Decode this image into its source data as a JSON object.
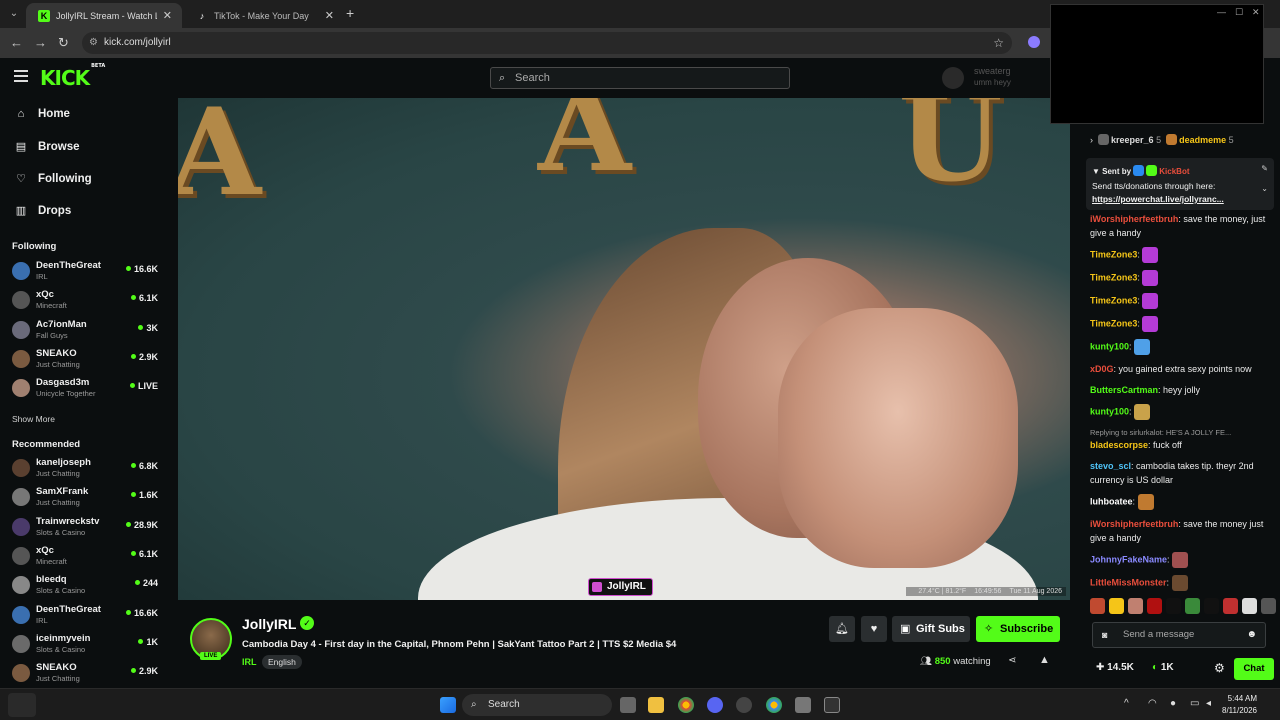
{
  "browser": {
    "tabs": [
      {
        "title": "JollyIRL Stream - Watch Liv",
        "favicon": "kick-icon"
      },
      {
        "title": "TikTok - Make Your Day",
        "favicon": "tiktok-icon"
      }
    ],
    "url": "kick.com/jollyirl"
  },
  "header": {
    "logo": "KICK",
    "logo_beta": "BETA",
    "search_placeholder": "Search",
    "user_name": "sweaterg",
    "user_sub": "umm heyy"
  },
  "sidebar": {
    "nav": [
      {
        "label": "Home",
        "icon": "home-icon"
      },
      {
        "label": "Browse",
        "icon": "browse-icon"
      },
      {
        "label": "Following",
        "icon": "heart-icon"
      },
      {
        "label": "Drops",
        "icon": "drops-icon"
      }
    ],
    "following_title": "Following",
    "following": [
      {
        "name": "DeenTheGreat",
        "category": "IRL",
        "viewers": "16.6K",
        "color": "#3a6fb0"
      },
      {
        "name": "xQc",
        "category": "Minecraft",
        "viewers": "6.1K",
        "color": "#555"
      },
      {
        "name": "Ac7ionMan",
        "category": "Fall Guys",
        "viewers": "3K",
        "color": "#6a6a7a"
      },
      {
        "name": "SNEAKO",
        "category": "Just Chatting",
        "viewers": "2.9K",
        "color": "#7a5a40"
      },
      {
        "name": "Dasgasd3m",
        "category": "Unicycle Together",
        "viewers": "LIVE",
        "color": "#a08070"
      }
    ],
    "show_more": "Show More",
    "recommended_title": "Recommended",
    "recommended": [
      {
        "name": "kaneljoseph",
        "category": "Just Chatting",
        "viewers": "6.8K",
        "color": "#5a4030"
      },
      {
        "name": "SamXFrank",
        "category": "Just Chatting",
        "viewers": "1.6K",
        "color": "#777"
      },
      {
        "name": "Trainwreckstv",
        "category": "Slots & Casino",
        "viewers": "28.9K",
        "color": "#4a3a6a"
      },
      {
        "name": "xQc",
        "category": "Minecraft",
        "viewers": "6.1K",
        "color": "#555"
      },
      {
        "name": "bleedq",
        "category": "Slots & Casino",
        "viewers": "244",
        "color": "#888"
      },
      {
        "name": "DeenTheGreat",
        "category": "IRL",
        "viewers": "16.6K",
        "color": "#3a6fb0"
      },
      {
        "name": "iceinmyvein",
        "category": "Slots & Casino",
        "viewers": "1K",
        "color": "#6a6a6a"
      },
      {
        "name": "SNEAKO",
        "category": "Just Chatting",
        "viewers": "2.9K",
        "color": "#7a5a40"
      }
    ]
  },
  "video": {
    "overlay_badge": "JollyIRL",
    "temp": "27.4°C | 81.2°F",
    "time": "16:49:56",
    "date": "Tue 11 Aug 2026"
  },
  "stream": {
    "name": "JollyIRL",
    "live_label": "LIVE",
    "title": "Cambodia Day 4 - First day in the Capital, Phnom Pehn | SakYant Tattoo Part 2 | TTS $2 Media $4",
    "category": "IRL",
    "language": "English",
    "gift_label": "Gift Subs",
    "subscribe_label": "Subscribe",
    "watching_count": "850",
    "watching_label": "watching"
  },
  "chat": {
    "top": [
      {
        "user": "kreeper_6",
        "count": "5"
      },
      {
        "user": "deadmeme",
        "count": "5"
      }
    ],
    "pinned": {
      "sent_by": "Sent by",
      "bot": "KickBot",
      "text": "Send tts/donations through here:",
      "link": "https://powerchat.live/jollyranc..."
    },
    "messages": [
      {
        "user": "iWorshipherfeetbruh",
        "text": "save the money, just give a handy",
        "color": "#e94e3c"
      },
      {
        "user": "TimeZone3",
        "text": "",
        "color": "#f5c518",
        "emote": "#b43bd6"
      },
      {
        "user": "TimeZone3",
        "text": "",
        "color": "#f5c518",
        "emote": "#b43bd6"
      },
      {
        "user": "TimeZone3",
        "text": "",
        "color": "#f5c518",
        "emote": "#b43bd6"
      },
      {
        "user": "TimeZone3",
        "text": "",
        "color": "#f5c518",
        "emote": "#b43bd6"
      },
      {
        "user": "kunty100",
        "text": "",
        "color": "#53fc18",
        "emote": "#4fa0e8"
      },
      {
        "user": "xD0G",
        "text": "you gained extra sexy points now",
        "color": "#e94e3c"
      },
      {
        "user": "ButtersCartman",
        "text": "heyy jolly",
        "color": "#53fc18"
      },
      {
        "user": "kunty100",
        "text": "",
        "color": "#53fc18",
        "emote": "#c9a24a"
      },
      {
        "user": "bladescorpse",
        "text": "fuck off",
        "color": "#f5c518",
        "reply": "Replying to sirlurkalot: HE'S A JOLLY FE..."
      },
      {
        "user": "stevo_scl",
        "text": "cambodia takes tip. theyr 2nd currency is US dollar",
        "color": "#4fc3f7"
      },
      {
        "user": "luhboatee",
        "text": "",
        "color": "#ffffff",
        "emote": "#c07a30"
      },
      {
        "user": "iWorshipherfeetbruh",
        "text": "save the money just give a handy",
        "color": "#e94e3c"
      },
      {
        "user": "JohnnyFakeName",
        "text": "",
        "color": "#8a8aff",
        "emote": "#a05050"
      },
      {
        "user": "LittleMissMonster",
        "text": "",
        "color": "#e94e3c",
        "emote": "#6a4a30"
      }
    ],
    "input_placeholder": "Send a message",
    "stat1": "14.5K",
    "stat2": "1K",
    "chat_button": "Chat"
  },
  "taskbar": {
    "search": "Search",
    "time": "5:44 AM",
    "date": "8/11/2026"
  }
}
